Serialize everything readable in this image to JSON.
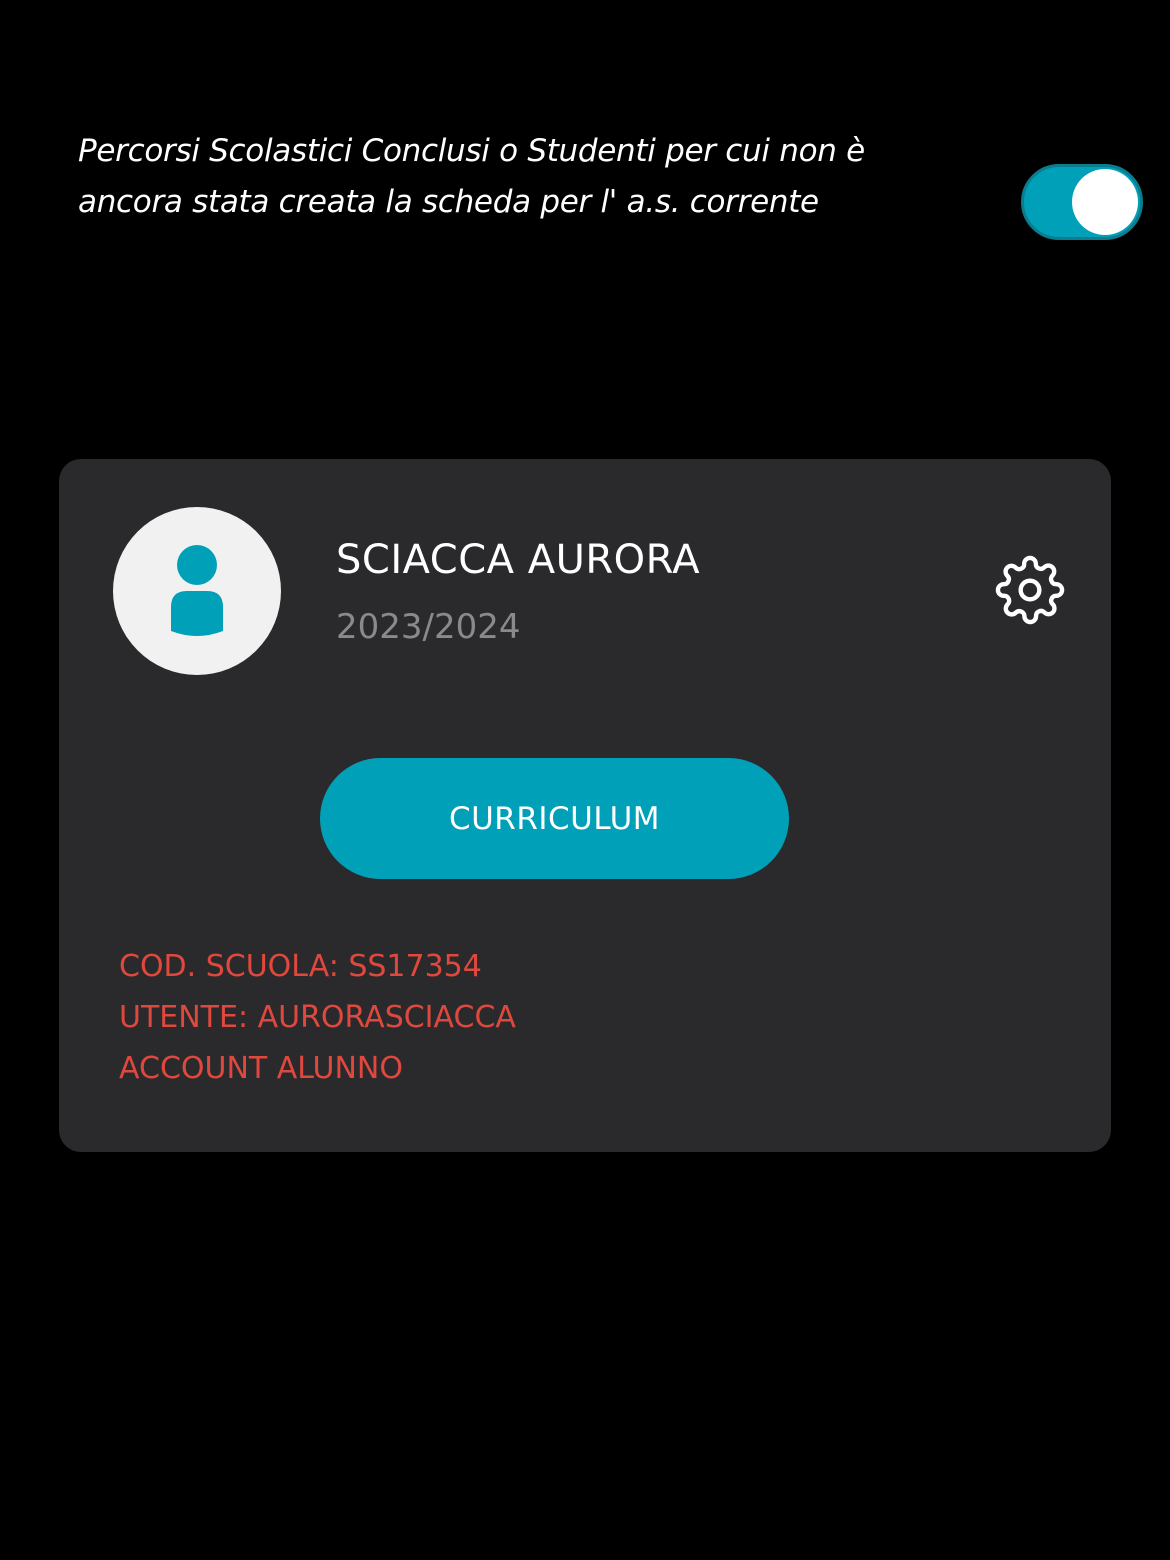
{
  "filter": {
    "label": "Percorsi Scolastici Conclusi o Studenti per cui non è ancora stata creata la scheda per l' a.s. corrente",
    "toggle_on": true,
    "toggle_color": "#00a0b8"
  },
  "student_card": {
    "name": "SCIACCA AURORA",
    "school_year": "2023/2024",
    "avatar_icon": "user-icon",
    "settings_icon": "gear-icon",
    "curriculum_label": "CURRICULUM",
    "accent_color": "#00a0b8",
    "info_color": "#e0483e",
    "info_lines": [
      "COD. SCUOLA: SS17354",
      "UTENTE: AURORASCIACCA",
      "ACCOUNT ALUNNO"
    ]
  }
}
